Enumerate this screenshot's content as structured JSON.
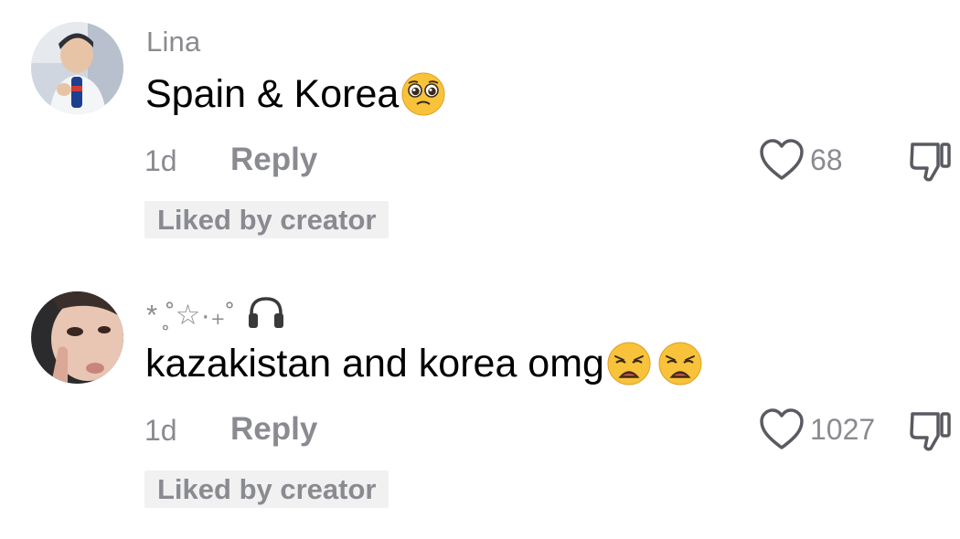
{
  "comments": [
    {
      "username": "Lina",
      "text": "Spain & Korea",
      "emojis": [
        "pleading-face"
      ],
      "time": "1d",
      "reply_label": "Reply",
      "likes": "68",
      "badge": "Liked by creator"
    },
    {
      "username": "* ̥˚☆·₊˚",
      "username_icon": "headphones-icon",
      "text": "kazakistan and korea omg",
      "emojis": [
        "weary-face",
        "weary-face"
      ],
      "time": "1d",
      "reply_label": "Reply",
      "likes": "1027",
      "badge": "Liked by creator"
    }
  ],
  "colors": {
    "secondary_text": "#8a8b91",
    "primary_text": "#000000",
    "badge_bg": "#f1f1f2",
    "emoji_yellow": "#f8c33a"
  }
}
